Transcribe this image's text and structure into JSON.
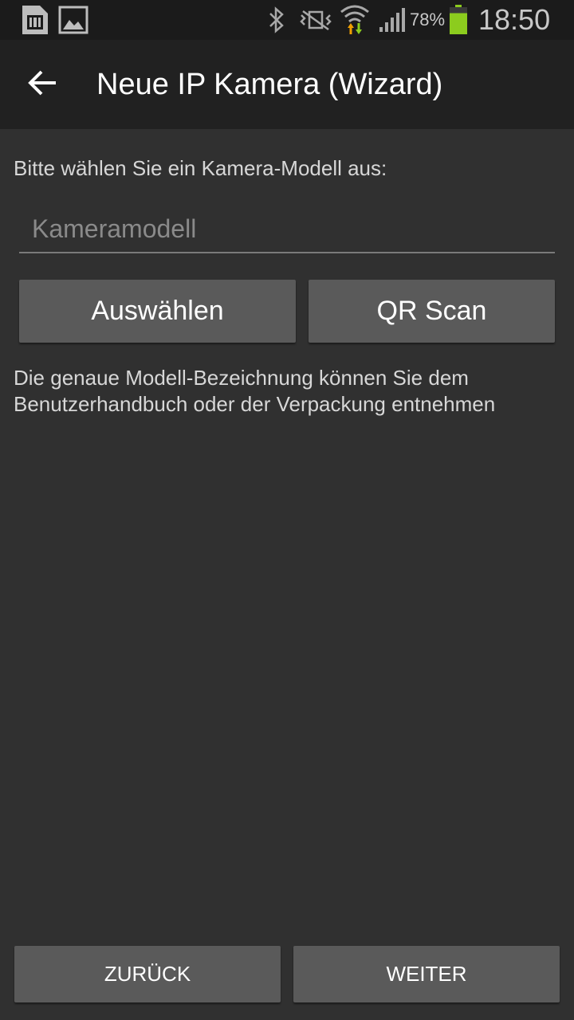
{
  "status_bar": {
    "icons_left": [
      "sim-card-icon",
      "gallery-icon"
    ],
    "icons_right": [
      "bluetooth-icon",
      "vibrate-icon",
      "wifi-icon",
      "signal-icon",
      "battery-icon"
    ],
    "battery_percent": "78%",
    "battery_level": 0.78,
    "time": "18:50",
    "battery_color": "#8ccc1e"
  },
  "action_bar": {
    "back_icon": "arrow-back-icon",
    "title": "Neue IP Kamera (Wizard)"
  },
  "content": {
    "prompt": "Bitte wählen Sie ein Kamera-Modell aus:",
    "model_input": {
      "value": "",
      "placeholder": "Kameramodell"
    },
    "select_button": "Auswählen",
    "qr_button": "QR Scan",
    "hint": "Die genaue Modell-Bezeichnung können Sie dem Benutzerhandbuch oder der Verpackung entnehmen"
  },
  "footer": {
    "back_button": "ZURÜCK",
    "next_button": "WEITER"
  }
}
